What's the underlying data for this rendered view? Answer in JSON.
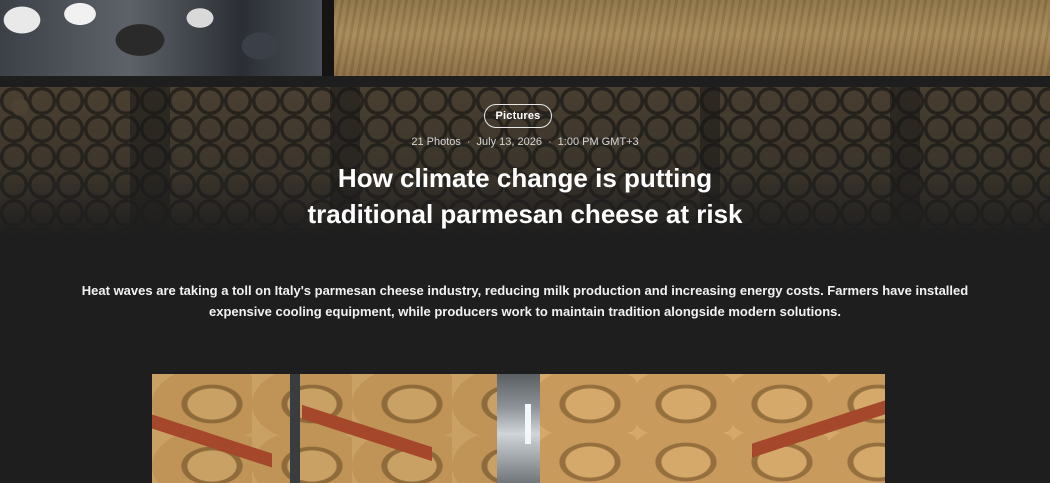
{
  "gallery": {
    "category_badge": "Pictures",
    "photo_count": "21 Photos",
    "date": "July 13, 2026",
    "time": "1:00 PM GMT+3",
    "separator": "·",
    "headline_line1": "How climate change is putting",
    "headline_line2": "traditional parmesan cheese at risk",
    "summary_line1": "Heat waves are taking a toll on Italy's parmesan cheese industry, reducing milk production and increasing energy costs. Farmers have installed",
    "summary_line2": "expensive cooling equipment, while producers work to maintain tradition alongside modern solutions."
  },
  "colors": {
    "page_background": "#1e1e1e",
    "text_primary": "#ffffff",
    "text_meta": "#d6d6d6",
    "badge_border": "#e8e8e8"
  }
}
